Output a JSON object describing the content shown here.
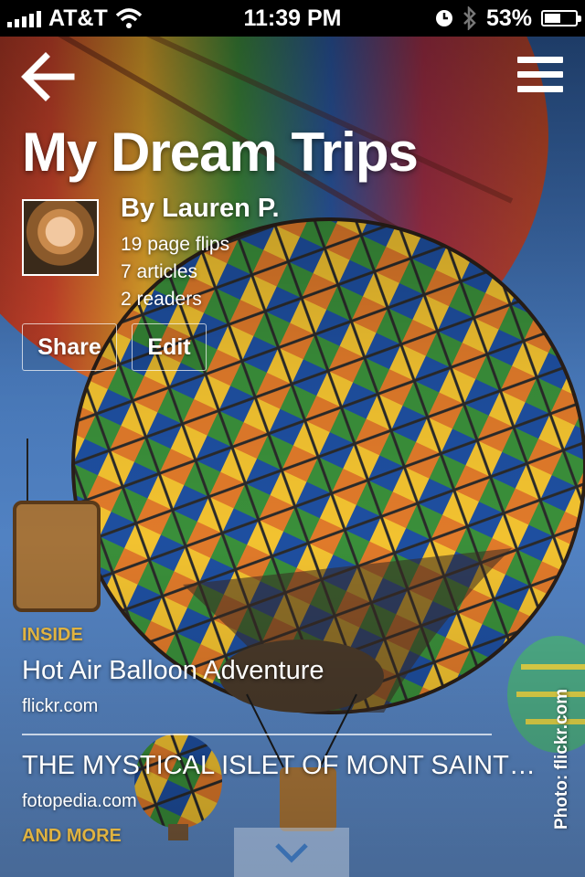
{
  "status_bar": {
    "carrier": "AT&T",
    "time": "11:39 PM",
    "battery_percent": "53%",
    "battery_level": 0.53,
    "icons": [
      "signal-icon",
      "wifi-icon",
      "clock-icon",
      "bluetooth-icon",
      "battery-icon"
    ]
  },
  "header": {
    "back_icon": "back-arrow-icon",
    "menu_icon": "menu-icon"
  },
  "magazine": {
    "title": "My Dream Trips",
    "author": "By Lauren P.",
    "stats": [
      "19 page flips",
      "7 articles",
      "2 readers"
    ],
    "share_label": "Share",
    "edit_label": "Edit"
  },
  "inside": {
    "label": "INSIDE",
    "articles": [
      {
        "title": "Hot Air Balloon Adventure",
        "source": "flickr.com"
      },
      {
        "title": "THE MYSTICAL ISLET OF MONT SAINT…",
        "source": "fotopedia.com"
      }
    ],
    "more_label": "AND MORE"
  },
  "photo_credit": "Photo: flickr.com",
  "scroll_icon": "chevron-down-icon",
  "colors": {
    "accent": "#e0b340",
    "status_bar": "#000000",
    "sky": "#4c7ec0"
  }
}
